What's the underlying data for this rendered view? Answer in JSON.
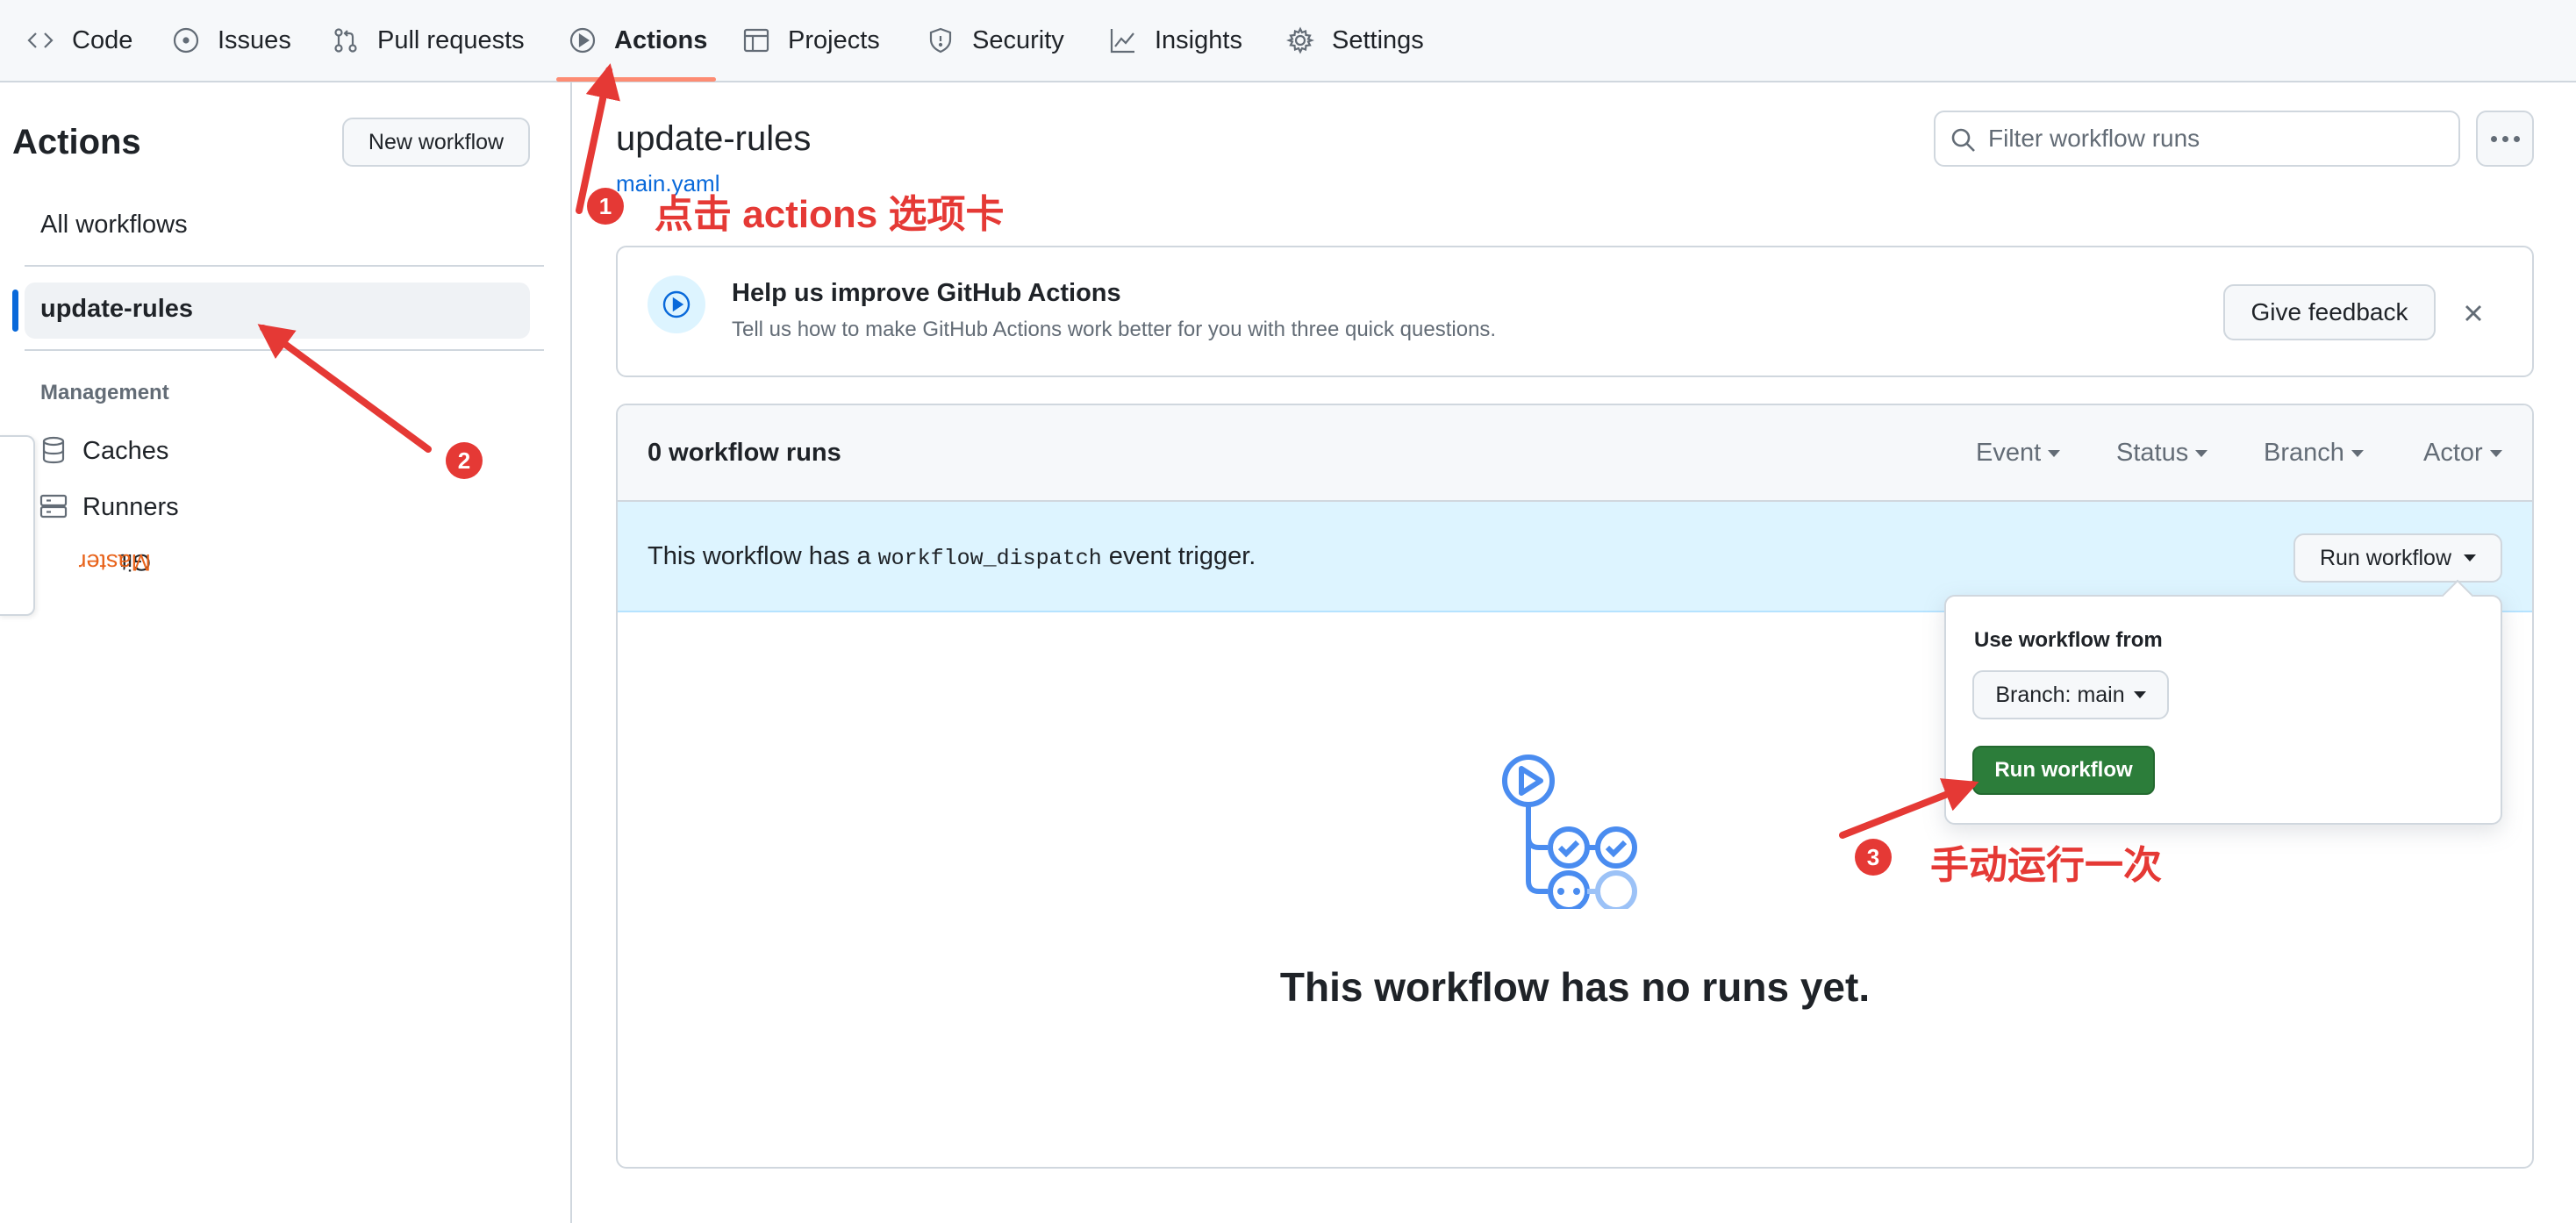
{
  "nav": {
    "items": [
      {
        "label": "Code",
        "icon": "code-icon"
      },
      {
        "label": "Issues",
        "icon": "issue-icon"
      },
      {
        "label": "Pull requests",
        "icon": "pull-request-icon"
      },
      {
        "label": "Actions",
        "icon": "play-icon",
        "active": true
      },
      {
        "label": "Projects",
        "icon": "table-icon"
      },
      {
        "label": "Security",
        "icon": "shield-icon"
      },
      {
        "label": "Insights",
        "icon": "graph-icon"
      },
      {
        "label": "Settings",
        "icon": "gear-icon"
      }
    ]
  },
  "sidebar": {
    "title": "Actions",
    "new_workflow": "New workflow",
    "all_workflows": "All workflows",
    "selected_workflow": "update-rules",
    "management_heading": "Management",
    "caches": "Caches",
    "runners": "Runners"
  },
  "git_master": {
    "prefix": "Git ",
    "name": "Master"
  },
  "main": {
    "title": "update-rules",
    "file_link": "main.yaml",
    "filter_placeholder": "Filter workflow runs"
  },
  "banner": {
    "title": "Help us improve GitHub Actions",
    "subtitle": "Tell us how to make GitHub Actions work better for you with three quick questions.",
    "feedback_button": "Give feedback"
  },
  "runs": {
    "count_label": "0 workflow runs",
    "filters": [
      "Event",
      "Status",
      "Branch",
      "Actor"
    ],
    "dispatch_prefix": "This workflow has a",
    "dispatch_code": "workflow_dispatch",
    "dispatch_suffix": "event trigger.",
    "run_workflow_button": "Run workflow",
    "empty_title": "This workflow has no runs yet."
  },
  "dropdown": {
    "label": "Use workflow from",
    "branch_button": "Branch: main",
    "run_button": "Run workflow"
  },
  "annotations": {
    "color": "#e53935",
    "step1": {
      "badge": "1",
      "text": "点击 actions 选项卡"
    },
    "step2": {
      "badge": "2"
    },
    "step3": {
      "badge": "3",
      "text": "手动运行一次"
    }
  },
  "colors": {
    "accent_blue": "#0969da",
    "run_green": "#2c7d3a",
    "tab_underline": "#fd8c73",
    "dispatch_bg": "#ddf4ff"
  }
}
